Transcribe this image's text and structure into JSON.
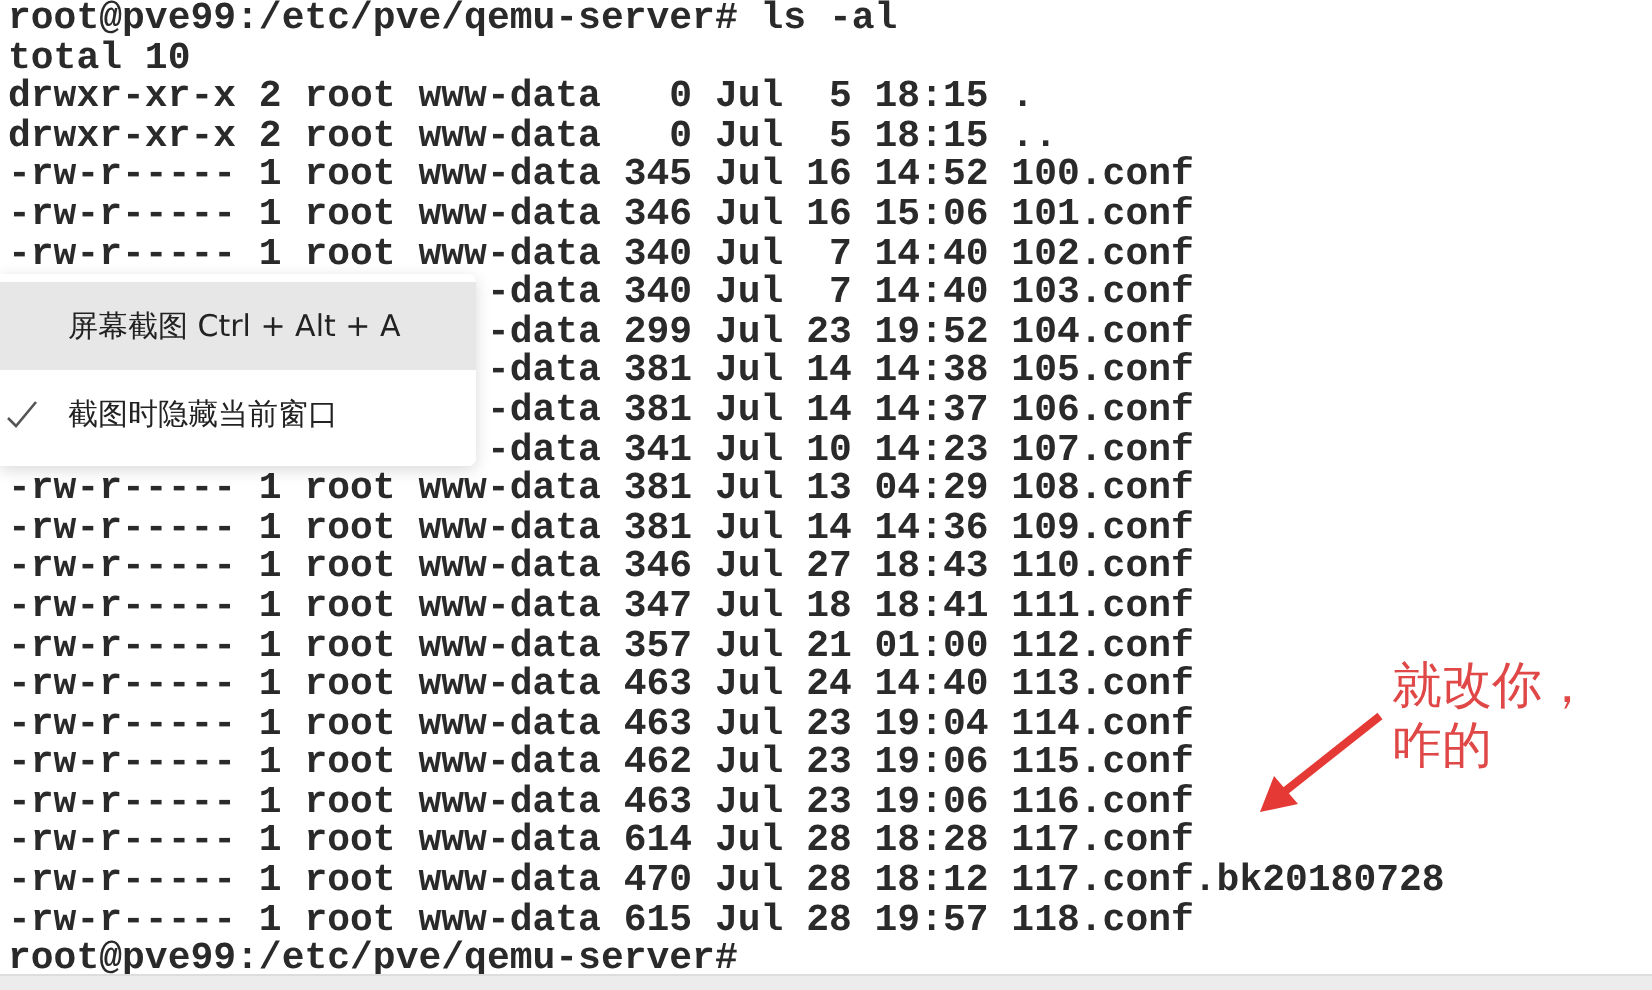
{
  "terminal": {
    "lines": [
      {
        "text": "root@pve99:/etc/pve/qemu-server# ls -al",
        "covered": false
      },
      {
        "text": "total 10",
        "covered": false
      },
      {
        "text": "drwxr-xr-x 2 root www-data   0 Jul  5 18:15 .",
        "covered": false
      },
      {
        "text": "drwxr-xr-x 2 root www-data   0 Jul  5 18:15 ..",
        "covered": false
      },
      {
        "text": "-rw-r----- 1 root www-data 345 Jul 16 14:52 100.conf",
        "covered": false
      },
      {
        "text": "-rw-r----- 1 root www-data 346 Jul 16 15:06 101.conf",
        "covered": false
      },
      {
        "text": "-rw-r----- 1 root www-data 340 Jul  7 14:40 102.conf",
        "covered": false
      },
      {
        "text": "-data 340 Jul  7 14:40 103.conf",
        "covered": true
      },
      {
        "text": "-data 299 Jul 23 19:52 104.conf",
        "covered": true
      },
      {
        "text": "-data 381 Jul 14 14:38 105.conf",
        "covered": true
      },
      {
        "text": "-data 381 Jul 14 14:37 106.conf",
        "covered": true
      },
      {
        "text": "-data 341 Jul 10 14:23 107.conf",
        "covered": true
      },
      {
        "text": "-rw-r----- 1 root www-data 381 Jul 13 04:29 108.conf",
        "covered": false
      },
      {
        "text": "-rw-r----- 1 root www-data 381 Jul 14 14:36 109.conf",
        "covered": false
      },
      {
        "text": "-rw-r----- 1 root www-data 346 Jul 27 18:43 110.conf",
        "covered": false
      },
      {
        "text": "-rw-r----- 1 root www-data 347 Jul 18 18:41 111.conf",
        "covered": false
      },
      {
        "text": "-rw-r----- 1 root www-data 357 Jul 21 01:00 112.conf",
        "covered": false
      },
      {
        "text": "-rw-r----- 1 root www-data 463 Jul 24 14:40 113.conf",
        "covered": false
      },
      {
        "text": "-rw-r----- 1 root www-data 463 Jul 23 19:04 114.conf",
        "covered": false
      },
      {
        "text": "-rw-r----- 1 root www-data 462 Jul 23 19:06 115.conf",
        "covered": false
      },
      {
        "text": "-rw-r----- 1 root www-data 463 Jul 23 19:06 116.conf",
        "covered": false
      },
      {
        "text": "-rw-r----- 1 root www-data 614 Jul 28 18:28 117.conf",
        "covered": false
      },
      {
        "text": "-rw-r----- 1 root www-data 470 Jul 28 18:12 117.conf.bk20180728",
        "covered": false
      },
      {
        "text": "-rw-r----- 1 root www-data 615 Jul 28 19:57 118.conf",
        "covered": false
      },
      {
        "text": "root@pve99:/etc/pve/qemu-server#",
        "covered": false
      }
    ]
  },
  "context_menu": {
    "items": [
      {
        "label": "屏幕截图 Ctrl + Alt + A",
        "checked": false,
        "selected": true
      },
      {
        "label": "截图时隐藏当前窗口",
        "checked": true,
        "selected": false
      }
    ]
  },
  "annotation": {
    "lines": [
      "就改你，",
      "咋的"
    ]
  }
}
